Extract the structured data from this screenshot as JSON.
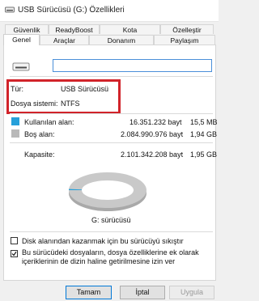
{
  "window": {
    "title": "USB Sürücüsü (G:) Özellikleri"
  },
  "tabs": {
    "row1": [
      "Güvenlik",
      "ReadyBoost",
      "Kota",
      "Özelleştir"
    ],
    "row2": [
      "Genel",
      "Araçlar",
      "Donanım",
      "Paylaşım"
    ],
    "active": "Genel"
  },
  "general": {
    "drive_name_value": "",
    "type_label": "Tür:",
    "type_value": "USB Sürücüsü",
    "fs_label": "Dosya sistemi:",
    "fs_value": "NTFS",
    "used": {
      "label": "Kullanılan alan:",
      "bytes": "16.351.232 bayt",
      "size": "15,5 MB",
      "color": "#26a0da"
    },
    "free": {
      "label": "Boş alan:",
      "bytes": "2.084.990.976 bayt",
      "size": "1,94 GB",
      "color": "#b9b9b9"
    },
    "capacity": {
      "label": "Kapasite:",
      "bytes": "2.101.342.208 bayt",
      "size": "1,95 GB"
    },
    "used_fraction": 0.0078,
    "drive_label": "G: sürücüsü",
    "compress_label": "Disk alanından kazanmak için bu sürücüyü sıkıştır",
    "compress_checked": false,
    "index_label": "Bu sürücüdeki dosyaların, dosya özelliklerine ek olarak içeriklerinin de dizin haline getirilmesine izin ver",
    "index_checked": true
  },
  "buttons": {
    "ok": "Tamam",
    "cancel": "İptal",
    "apply": "Uygula"
  }
}
